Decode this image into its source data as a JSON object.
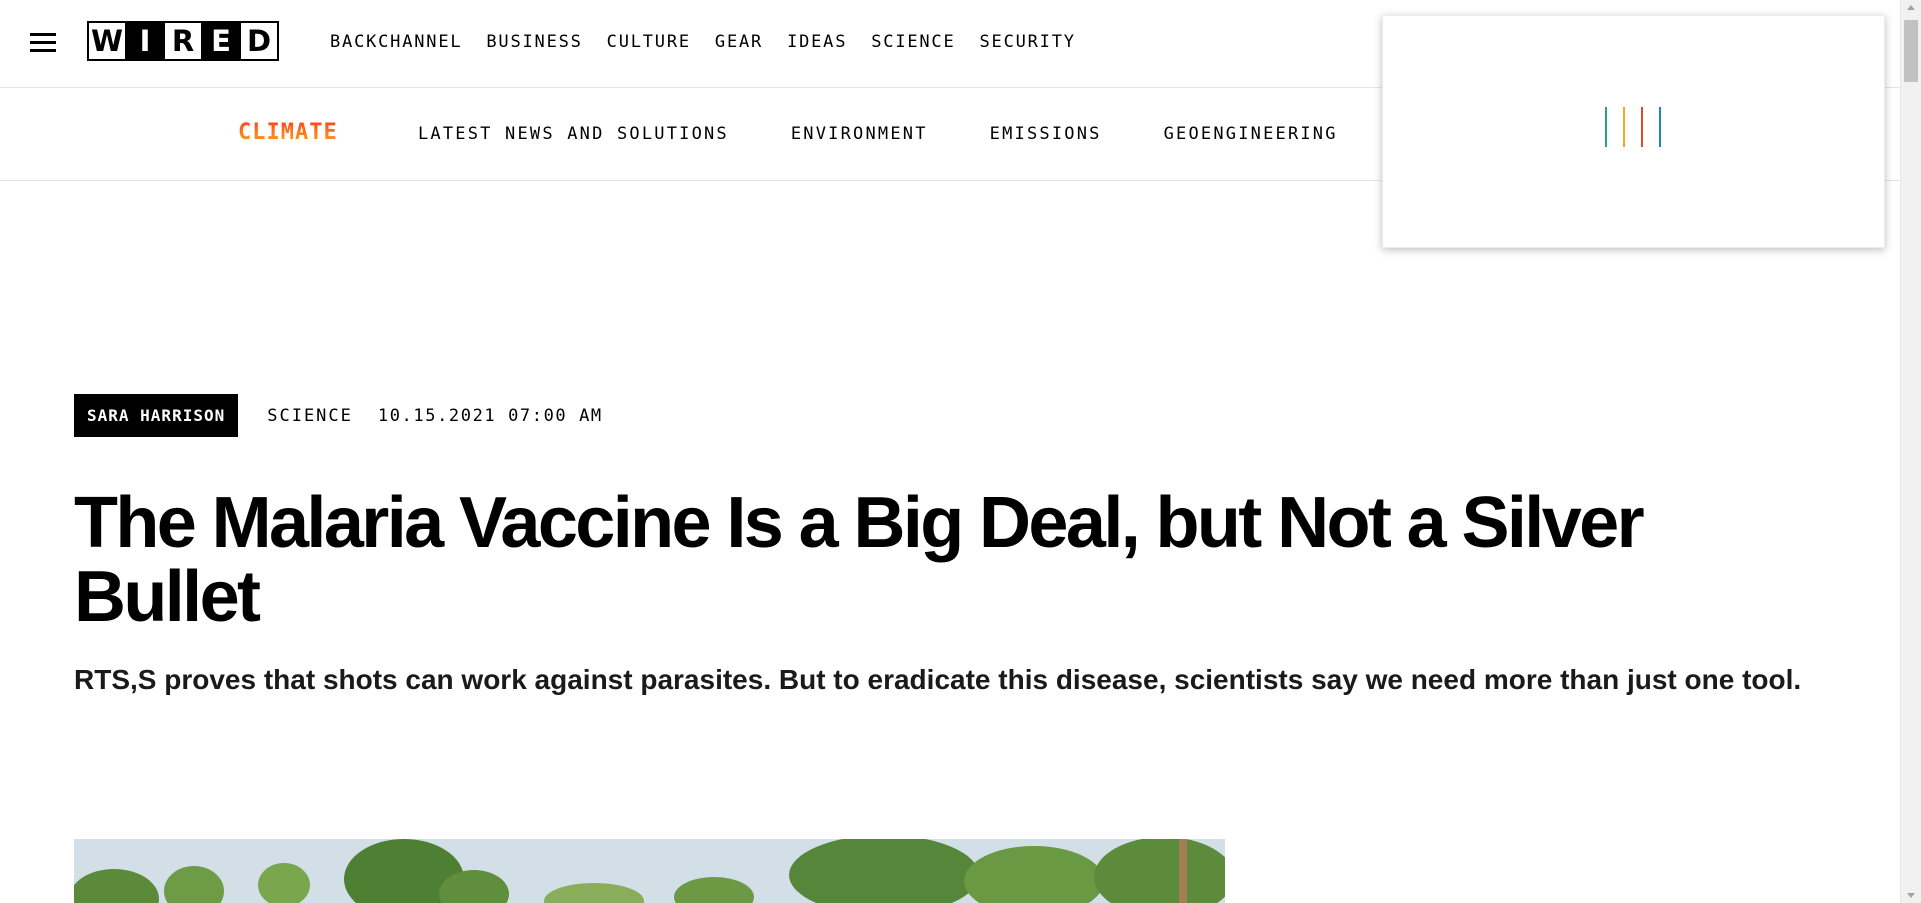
{
  "header": {
    "logo_letters": [
      "W",
      "I",
      "R",
      "E",
      "D"
    ],
    "nav_items": [
      "BACKCHANNEL",
      "BUSINESS",
      "CULTURE",
      "GEAR",
      "IDEAS",
      "SCIENCE",
      "SECURITY"
    ]
  },
  "subnav": {
    "brand": "CLIMATE",
    "items": [
      "LATEST NEWS AND SOLUTIONS",
      "ENVIRONMENT",
      "EMISSIONS",
      "GEOENGINEERING"
    ]
  },
  "ad_loader": {
    "bar_colors": [
      "#2aa57a",
      "#f2a624",
      "#d94f2b",
      "#2a7fbf"
    ]
  },
  "article": {
    "author": "SARA HARRISON",
    "section": "SCIENCE",
    "date": "10.15.2021 07:00 AM",
    "title": "The Malaria Vaccine Is a Big Deal, but Not a Silver Bullet",
    "dek": "RTS,S proves that shots can work against parasites. But to eradicate this disease, scientists say we need more than just one tool."
  },
  "colors": {
    "climate_gradient": [
      "#ff3b1f",
      "#ff7a1a",
      "#f5a21e"
    ]
  }
}
